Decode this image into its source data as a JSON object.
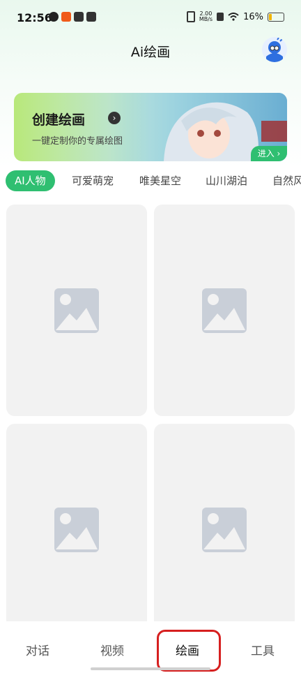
{
  "status": {
    "time": "12:56",
    "net_speed_value": "2.00",
    "net_speed_unit": "MB/s",
    "battery": "16%",
    "battery_level": 0.16
  },
  "header": {
    "title": "Ai绘画"
  },
  "banner": {
    "title": "创建绘画",
    "subtitle": "一键定制你的专属绘图",
    "enter_label": "进入 ›"
  },
  "tabs": [
    {
      "label": "AI人物",
      "active": true
    },
    {
      "label": "可爱萌宠"
    },
    {
      "label": "唯美星空"
    },
    {
      "label": "山川湖泊"
    },
    {
      "label": "自然风"
    }
  ],
  "gallery": {
    "items": [
      {
        "icon": "image-placeholder-icon"
      },
      {
        "icon": "image-placeholder-icon"
      },
      {
        "icon": "image-placeholder-icon"
      },
      {
        "icon": "image-placeholder-icon"
      }
    ]
  },
  "bottom_nav": [
    {
      "label": "对话"
    },
    {
      "label": "视频"
    },
    {
      "label": "绘画",
      "active": true
    },
    {
      "label": "工具"
    }
  ],
  "colors": {
    "accent": "#2fbf71",
    "highlight": "#d61f1f",
    "placeholder_bg": "#f2f2f2",
    "placeholder_icon": "#c9cfd8"
  }
}
